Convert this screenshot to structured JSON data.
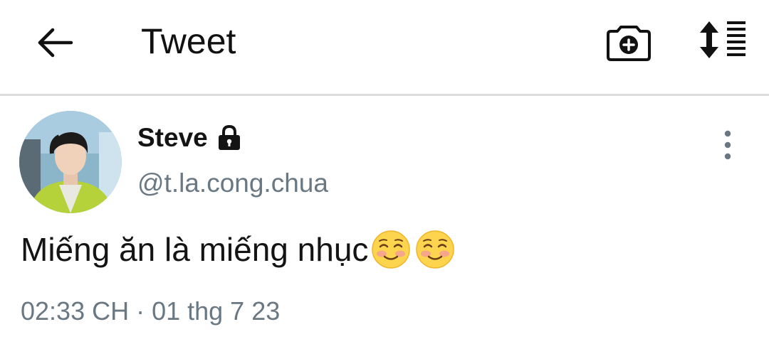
{
  "header": {
    "title": "Tweet",
    "back_icon": "arrow-left-icon",
    "camera_icon": "camera-add-icon",
    "sort_icon": "sort-lines-icon"
  },
  "tweet": {
    "author_name": "Steve",
    "handle": "@t.la.cong.chua",
    "protected_icon": "lock-icon",
    "more_icon": "more-vertical-icon",
    "text": "Miếng ăn là miếng nhục",
    "emojis": [
      "smiling-face-icon",
      "smiling-face-icon"
    ],
    "timestamp": "02:33 CH · 01 thg 7 23"
  },
  "colors": {
    "primary_text": "#141414",
    "secondary_text": "#697883",
    "divider": "#dcdcdc"
  }
}
